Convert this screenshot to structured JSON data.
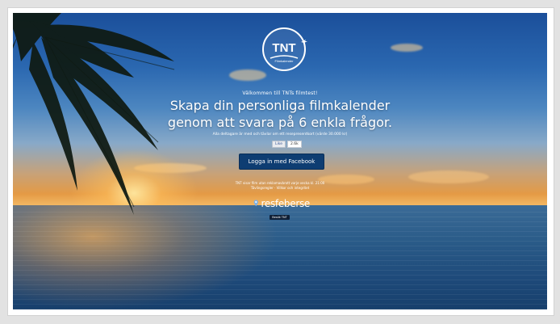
{
  "brand": {
    "logo_text": "TNT",
    "logo_subtext": "Filmkalender"
  },
  "intro": {
    "welcome": "Välkommen till TNTs filmtest!",
    "headline_line1": "Skapa din personliga filmkalender",
    "headline_line2": "genom att svara på 6 enkla frågor.",
    "subtext": "Alla deltagare är med och tävlar om ett resepresentkort (värde 30.000 kr)"
  },
  "social": {
    "like_label": "Like",
    "like_count": "2.6k"
  },
  "login": {
    "button_label": "Logga in med Facebook"
  },
  "fineprint": {
    "line1": "TNT visar film utan reklamavbrott varje vecka kl. 21:00",
    "line2": "Tävlingsregler · Villkor och integritet"
  },
  "partner": {
    "name": "resfeberse"
  },
  "about": {
    "label": "Besök TNT"
  },
  "colors": {
    "button_bg": "#0e3d72",
    "frame_bg": "#e2e2e2"
  }
}
